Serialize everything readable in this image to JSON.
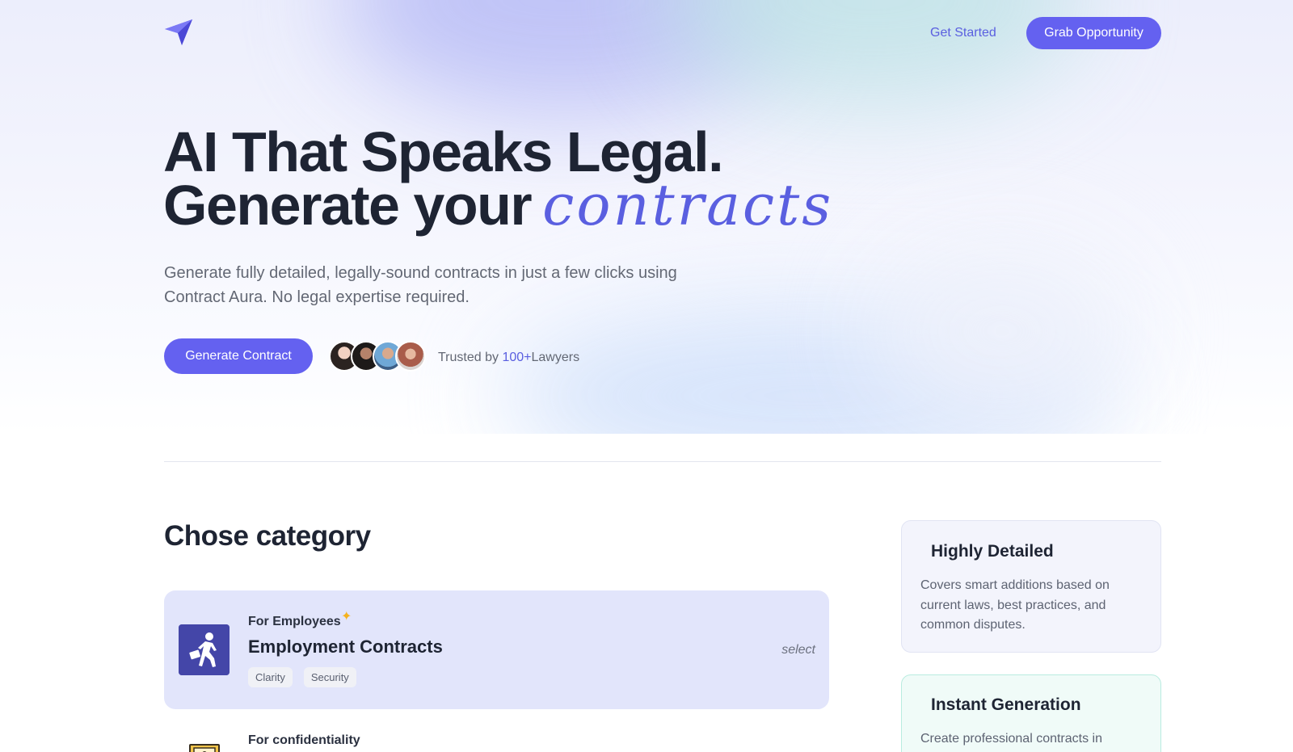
{
  "nav": {
    "logo_icon": "paper-plane-icon",
    "get_started_label": "Get Started",
    "cta_label": "Grab Opportunity"
  },
  "hero": {
    "title_line1": "AI That Speaks Legal.",
    "title_line2_prefix": "Generate your",
    "title_line2_script": "contracts",
    "subtitle": "Generate fully detailed, legally-sound contracts in just a few clicks using Contract Aura. No legal expertise required.",
    "generate_button_label": "Generate Contract",
    "trusted_prefix": "Trusted by ",
    "trusted_count": "100+",
    "trusted_suffix": "Lawyers"
  },
  "categories": {
    "section_title": "Chose category",
    "items": [
      {
        "kicker": "For Employees",
        "title": "Employment Contracts",
        "icon": "employee-walking-icon",
        "tags": [
          "Clarity",
          "Security"
        ],
        "select_label": "select",
        "highlighted": true
      },
      {
        "kicker": "For confidentiality",
        "icon": "certificate-icon"
      }
    ]
  },
  "features": [
    {
      "title": "Highly Detailed",
      "description": "Covers smart additions based on current laws, best practices, and common disputes."
    },
    {
      "title": "Instant Generation",
      "description": "Create professional contracts in"
    }
  ],
  "colors": {
    "accent": "#6461f0",
    "accent_text": "#5a5fe0",
    "heading": "#1e2433",
    "category_card_bg": "#e2e5fb",
    "category_icon_bg": "#4446a8",
    "sparkle": "#f5b21e",
    "feature_mint_border": "#b9ece0"
  }
}
